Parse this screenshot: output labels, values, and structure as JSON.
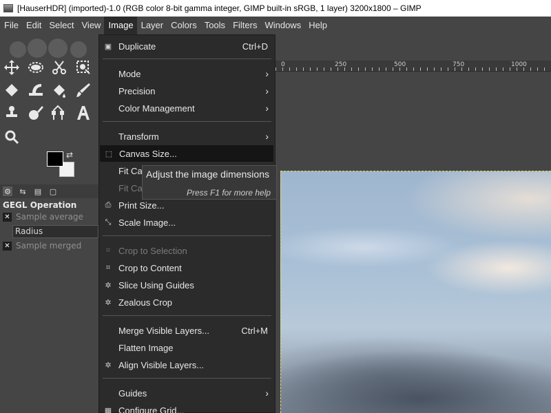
{
  "window": {
    "title": "[HauserHDR] (imported)-1.0 (RGB color 8-bit gamma integer, GIMP built-in sRGB, 1 layer) 3200x1800 – GIMP"
  },
  "menubar": {
    "items": [
      "File",
      "Edit",
      "Select",
      "View",
      "Image",
      "Layer",
      "Colors",
      "Tools",
      "Filters",
      "Windows",
      "Help"
    ],
    "active": "Image"
  },
  "tool_options": {
    "title": "GEGL Operation",
    "sample_average": "Sample average",
    "radius_value": "Radius",
    "sample_merged": "Sample merged"
  },
  "ruler": {
    "labels": [
      "0",
      "250",
      "500",
      "750",
      "1000"
    ]
  },
  "image_menu": {
    "duplicate": {
      "label": "Duplicate",
      "accel": "Ctrl+D"
    },
    "mode": "Mode",
    "precision": "Precision",
    "color_management": "Color Management",
    "transform": "Transform",
    "canvas_size": "Canvas Size...",
    "fit_canvas_layers": "Fit Canvas to Layers",
    "fit_canvas_selection": "Fit Canvas to Selection",
    "print_size": "Print Size...",
    "scale_image": "Scale Image...",
    "crop_to_selection": "Crop to Selection",
    "crop_to_content": "Crop to Content",
    "slice_using_guides": "Slice Using Guides",
    "zealous_crop": "Zealous Crop",
    "merge_visible_layers": {
      "label": "Merge Visible Layers...",
      "accel": "Ctrl+M"
    },
    "flatten_image": "Flatten Image",
    "align_visible_layers": "Align Visible Layers...",
    "guides": "Guides",
    "configure_grid": "Configure Grid..."
  },
  "tooltip": {
    "text": "Adjust the image dimensions",
    "help": "Press F1 for more help"
  },
  "colors": {
    "foreground": "#000000",
    "background": "#f2f2f2",
    "selection_outline": "#e0e05a"
  }
}
